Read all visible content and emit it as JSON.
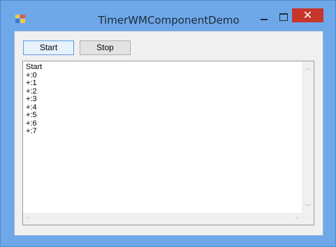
{
  "window": {
    "title": "TimerWMComponentDemo"
  },
  "titlebar_buttons": {
    "minimize": "minimize",
    "maximize": "maximize",
    "close_glyph": "✕"
  },
  "toolbar": {
    "start_label": "Start",
    "stop_label": "Stop"
  },
  "log": {
    "lines": [
      "Start",
      "+:0",
      "+:1",
      "+:2",
      "+:3",
      "+:4",
      "+:5",
      "+:6",
      "+:7"
    ]
  },
  "icons": {
    "app": "app-icon",
    "scroll_up": "chevron-up-icon",
    "scroll_down": "chevron-down-icon",
    "scroll_left": "chevron-left-icon",
    "scroll_right": "chevron-right-icon"
  },
  "colors": {
    "frame": "#6fa8e8",
    "close": "#c7352b",
    "client": "#f0f0f0",
    "start_border": "#5f9de0"
  }
}
